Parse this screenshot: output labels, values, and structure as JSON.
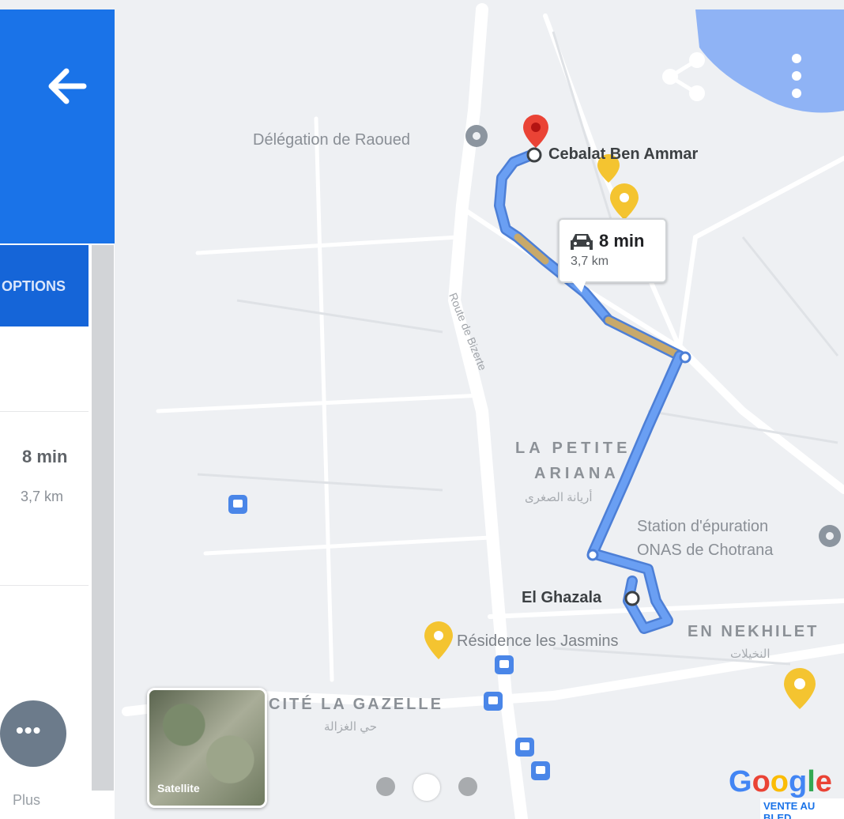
{
  "header": {
    "back_icon": "arrow-left-icon",
    "share_icon": "share-icon",
    "menu_icon": "more-vert-icon"
  },
  "side_panel": {
    "options_label": "OPTIONS",
    "route_time": "8 min",
    "route_distance": "3,7 km",
    "more_label": "Plus"
  },
  "map": {
    "destination": "Cebalat Ben Ammar",
    "origin": "El Ghazala",
    "places": {
      "delegation": "Délégation de Raoued",
      "station_line1": "Station d'épuration",
      "station_line2": "ONAS de Chotrana",
      "residence": "Résidence les Jasmins"
    },
    "districts": {
      "petite_ariana_line1": "LA PETITE",
      "petite_ariana_line2": "ARIANA",
      "petite_ariana_ar": "أريانة الصغرى",
      "nekhilet": "EN NEKHILET",
      "nekhilet_ar": "النخيلات",
      "gazelle": "CITÉ LA GAZELLE",
      "gazelle_ar": "حي الغزالة"
    },
    "road_label": "Route de Bizerte",
    "route_callout": {
      "time": "8 min",
      "distance": "3,7 km"
    },
    "satellite_label": "Satellite",
    "google_logo": "Google",
    "watermark": "VENTE AU BLED"
  },
  "colors": {
    "route": "#6a9ff3",
    "traffic": "#c8a96a",
    "accent": "#1a73e8",
    "poi_yellow": "#f4c430",
    "pin_red": "#ea4335"
  },
  "pager": {
    "pages": 3,
    "active_index": 1
  }
}
